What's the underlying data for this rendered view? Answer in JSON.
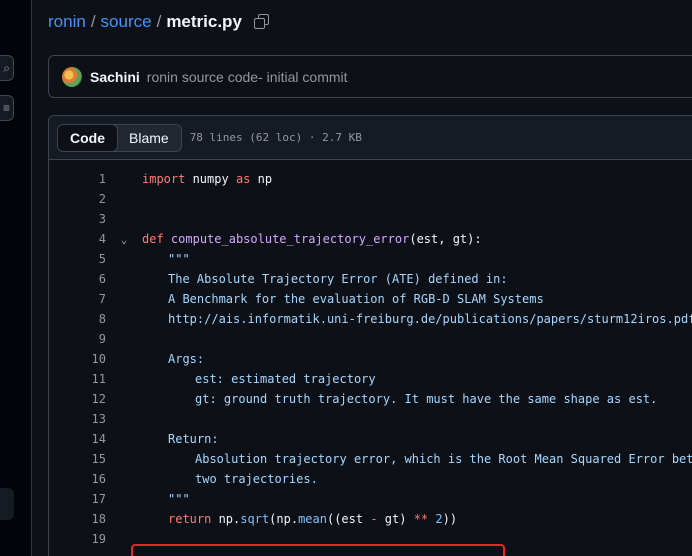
{
  "breadcrumb": {
    "repo": "ronin",
    "folder": "source",
    "file": "metric.py",
    "sep": "/"
  },
  "commit": {
    "author": "Sachini",
    "message": "ronin source code- initial commit"
  },
  "file_header": {
    "code_tab": "Code",
    "blame_tab": "Blame",
    "info": "78 lines (62 loc) · 2.7 KB"
  },
  "code": {
    "l1": "1",
    "l2": "2",
    "l3": "3",
    "l4": "4",
    "l5": "5",
    "l6": "6",
    "l7": "7",
    "l8": "8",
    "l9": "9",
    "l10": "10",
    "l11": "11",
    "l12": "12",
    "l13": "13",
    "l14": "14",
    "l15": "15",
    "l16": "16",
    "l17": "17",
    "l18": "18",
    "l19": "19",
    "import_kw": "import",
    "numpy": " numpy ",
    "as_kw": "as",
    "np": " np",
    "def_kw": "def",
    "func_name": "compute_absolute_trajectory_error",
    "params": "(est, gt):",
    "doc_open": "\"\"\"",
    "doc_line1": "The Absolute Trajectory Error (ATE) defined in:",
    "doc_line2": "A Benchmark for the evaluation of RGB-D SLAM Systems",
    "doc_line3": "http://ais.informatik.uni-freiburg.de/publications/papers/sturm12iros.pdf",
    "args_hdr": "Args:",
    "arg_est": "est: estimated trajectory",
    "arg_gt": "gt: ground truth trajectory. It must have the same shape as est.",
    "return_hdr": "Return:",
    "return_line1": "Absolution trajectory error, which is the Root Mean Squared Error between",
    "return_line2": "two trajectories.",
    "doc_close": "\"\"\"",
    "return_kw": "return",
    "ret_np": " np.",
    "sqrt": "sqrt",
    "ret_mid": "(np.",
    "mean": "mean",
    "ret_args": "((est ",
    "minus": "-",
    "ret_gt": " gt) ",
    "pow": "**",
    "ret_sp": " ",
    "two": "2",
    "ret_end": "))"
  }
}
